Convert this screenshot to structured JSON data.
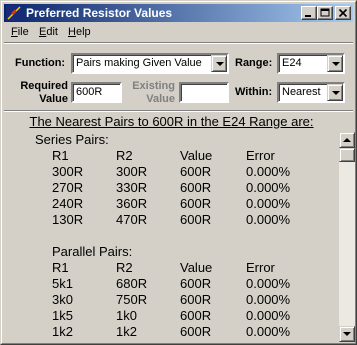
{
  "window": {
    "title": "Preferred Resistor Values",
    "icon": "resistor-app-icon"
  },
  "titlebar_buttons": {
    "minimize": "_",
    "maximize": "□",
    "close": "×"
  },
  "menu": [
    {
      "label": "File",
      "key": "F",
      "rest": "ile"
    },
    {
      "label": "Edit",
      "key": "E",
      "rest": "dit"
    },
    {
      "label": "Help",
      "key": "H",
      "rest": "elp"
    }
  ],
  "controls": {
    "function_label": "Function:",
    "function_value": "Pairs making Given Value",
    "range_label": "Range:",
    "range_value": "E24",
    "required_label_line1": "Required",
    "required_label_line2": "Value",
    "required_value": "600R",
    "existing_label_line1": "Existing",
    "existing_label_line2": "Value",
    "existing_value": "",
    "within_label": "Within:",
    "within_value": "Nearest"
  },
  "results": {
    "heading": "The Nearest Pairs to 600R in the E24 Range are:",
    "columns": [
      "R1",
      "R2",
      "Value",
      "Error"
    ],
    "series": {
      "title": "Series Pairs:",
      "rows": [
        [
          "300R",
          "300R",
          "600R",
          "0.000%"
        ],
        [
          "270R",
          "330R",
          "600R",
          "0.000%"
        ],
        [
          "240R",
          "360R",
          "600R",
          "0.000%"
        ],
        [
          "130R",
          "470R",
          "600R",
          "0.000%"
        ]
      ]
    },
    "parallel": {
      "title": "Parallel Pairs:",
      "rows": [
        [
          "5k1",
          "680R",
          "600R",
          "0.000%"
        ],
        [
          "3k0",
          "750R",
          "600R",
          "0.000%"
        ],
        [
          "1k5",
          "1k0",
          "600R",
          "0.000%"
        ],
        [
          "1k2",
          "1k2",
          "600R",
          "0.000%"
        ]
      ]
    }
  },
  "colors": {
    "titlebar_start": "#0a246a",
    "titlebar_end": "#a6caf0",
    "face": "#d4d0c8",
    "disabled_text": "#808080"
  }
}
